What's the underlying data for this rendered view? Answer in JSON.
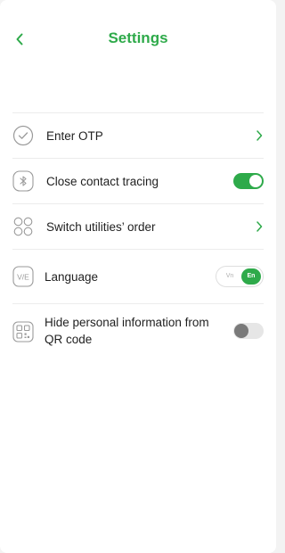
{
  "header": {
    "title": "Settings",
    "back_icon": "chevron-left-icon"
  },
  "colors": {
    "accent": "#2eaa4a",
    "divider": "#ececec",
    "icon_gray": "#9a9a9a"
  },
  "settings": {
    "enter_otp": {
      "label": "Enter OTP",
      "icon": "check-circle-icon",
      "control": "chevron-right"
    },
    "contact_tracing": {
      "label": "Close contact tracing",
      "icon": "bluetooth-icon",
      "control": "toggle",
      "on": true
    },
    "utilities_order": {
      "label": "Switch utilities’ order",
      "icon": "four-circles-icon",
      "control": "chevron-right"
    },
    "language": {
      "label": "Language",
      "icon": "ve-icon",
      "icon_text": "V/E",
      "control": "segmented",
      "options": [
        "Vn",
        "En"
      ],
      "selected": "En"
    },
    "hide_personal": {
      "label": "Hide personal information from QR code",
      "icon": "qr-code-icon",
      "control": "toggle",
      "on": false
    }
  }
}
